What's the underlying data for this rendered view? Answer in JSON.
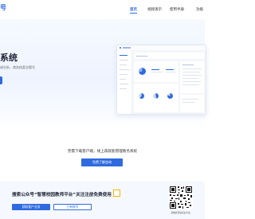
{
  "header": {
    "logo_fragment": "号",
    "nav": {
      "home": "首页",
      "video": "视频演示",
      "manual": "使用手册",
      "more": "功能"
    }
  },
  "hero": {
    "title": "系统",
    "subtitle": "成分析、商务档案全镀号"
  },
  "cta": {
    "text": "完需下载客户端，线上再就能管理教务系统",
    "button_label": "免费了解咨询"
  },
  "wechat": {
    "text": "搜索公众号“智慧校园教师平台”关注注册免费使用",
    "client_button": "获取客户业务",
    "account_button": "已有账号",
    "qr_caption": "微信扫码关注平台"
  },
  "colors": {
    "brand": "#2f6bdf",
    "highlight": "#f4b400"
  }
}
